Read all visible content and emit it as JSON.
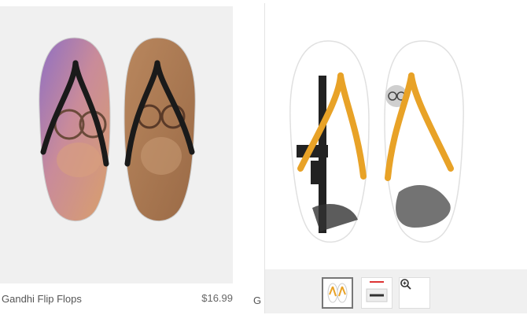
{
  "product_left": {
    "title": "Gandhi Flip Flops",
    "price": "$16.99",
    "image_icon": "gandhi-portrait-flip-flops"
  },
  "product_right": {
    "title_fragment": "G",
    "image_icon": "rifle-and-gandhi-flip-flops",
    "thumbnails": [
      {
        "icon": "flip-flop-front-thumbnail",
        "selected": true
      },
      {
        "icon": "flip-flop-side-thumbnail",
        "selected": false
      },
      {
        "icon": "zoom-icon",
        "selected": false
      }
    ]
  },
  "colors": {
    "panel_bg": "#f0f0f0",
    "strap_orange": "#e8a227",
    "strap_black": "#1a1a1a"
  }
}
